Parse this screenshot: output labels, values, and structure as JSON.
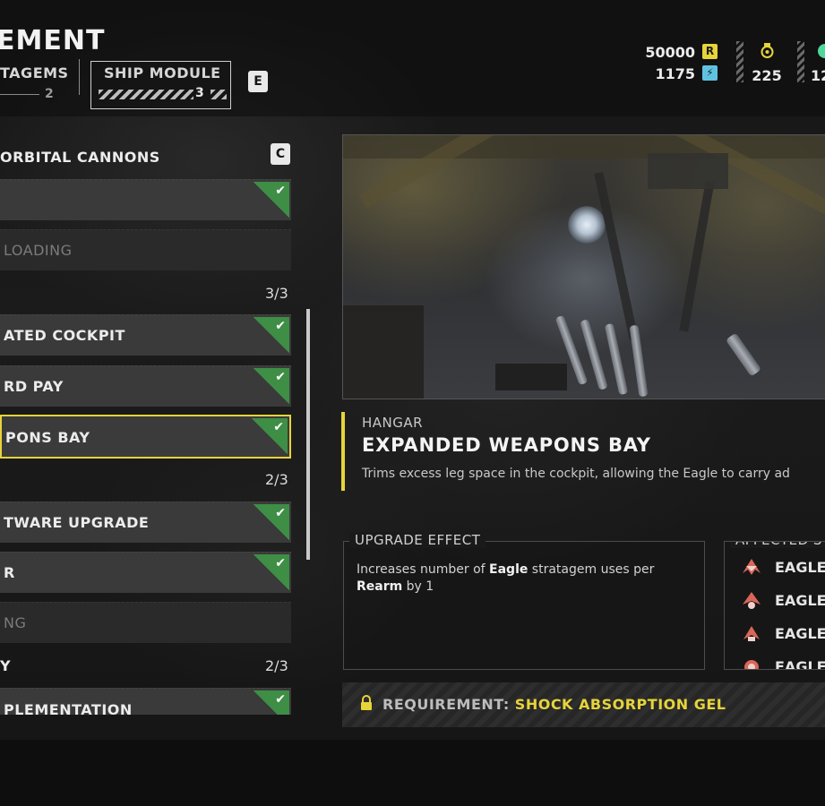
{
  "header": {
    "title": "EMENT",
    "tabs": [
      {
        "label": "TAGEMS",
        "count": "2"
      },
      {
        "label": "SHIP MODULE",
        "count": "3"
      }
    ],
    "tab_key": "E"
  },
  "currency": {
    "requisition": {
      "value": "50000",
      "icon": "R"
    },
    "samples": {
      "value": "1175",
      "icon": "⚡"
    },
    "medals": {
      "value": "225"
    },
    "other": {
      "value": "12"
    }
  },
  "list": {
    "section_title": "ORBITAL CANNONS",
    "section_key": "C",
    "rows": [
      {
        "label": "",
        "checked": true,
        "locked": false,
        "selected": false
      },
      {
        "label": "LOADING",
        "checked": false,
        "locked": true,
        "selected": false
      },
      {
        "label": "ATED COCKPIT",
        "checked": true,
        "locked": false,
        "selected": false
      },
      {
        "label": "RD PAY",
        "checked": true,
        "locked": false,
        "selected": false
      },
      {
        "label": "PONS BAY",
        "checked": true,
        "locked": false,
        "selected": true
      },
      {
        "label": "TWARE UPGRADE",
        "checked": true,
        "locked": false,
        "selected": false
      },
      {
        "label": "R",
        "checked": true,
        "locked": false,
        "selected": false
      },
      {
        "label": "NG",
        "checked": false,
        "locked": true,
        "selected": false
      },
      {
        "label": "PLEMENTATION",
        "checked": true,
        "locked": false,
        "selected": false
      }
    ],
    "counts": [
      "3/3",
      "2/3",
      "2/3"
    ],
    "subheads": [
      "Y"
    ],
    "checkmark": "✔"
  },
  "detail": {
    "category": "HANGAR",
    "title": "EXPANDED WEAPONS BAY",
    "description": "Trims excess leg space in the cockpit, allowing the Eagle to carry ad",
    "effect_label": "UPGRADE EFFECT",
    "effect_text_1": "Increases number of ",
    "effect_bold_1": "Eagle",
    "effect_text_2": " stratagem uses per",
    "effect_bold_2": "Rearm",
    "effect_text_3": " by 1",
    "affected_label": "AFFECTED S",
    "affected_items": [
      "EAGLE",
      "EAGLE",
      "EAGLE",
      "EAGLE"
    ],
    "requirement_label": "REQUIREMENT: ",
    "requirement_value": "SHOCK ABSORPTION GEL"
  },
  "colors": {
    "accent_yellow": "#e6d43a",
    "check_green": "#3e8e46",
    "samples_blue": "#5fc3e0",
    "eagle_red": "#d8675a"
  }
}
